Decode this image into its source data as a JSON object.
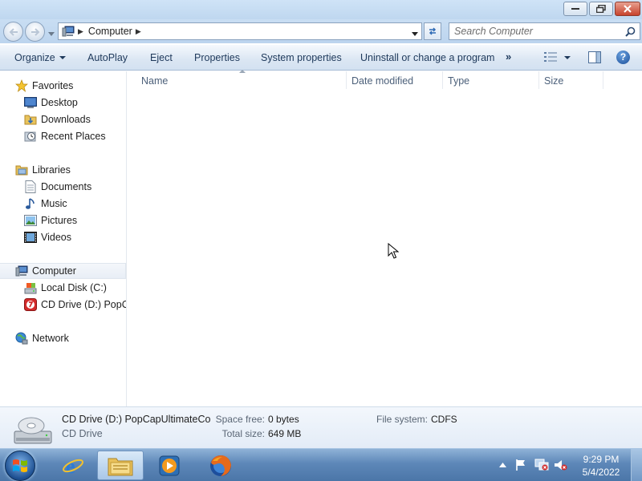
{
  "address": {
    "crumb": "Computer"
  },
  "search": {
    "placeholder": "Search Computer"
  },
  "toolbar": {
    "organize": "Organize",
    "autoplay": "AutoPlay",
    "eject": "Eject",
    "properties": "Properties",
    "system_properties": "System properties",
    "uninstall": "Uninstall or change a program",
    "more": "»",
    "help": "?"
  },
  "nav": {
    "favorites": "Favorites",
    "desktop": "Desktop",
    "downloads": "Downloads",
    "recent_places": "Recent Places",
    "libraries": "Libraries",
    "documents": "Documents",
    "music": "Music",
    "pictures": "Pictures",
    "videos": "Videos",
    "computer": "Computer",
    "local_disk": "Local Disk (C:)",
    "cd_drive": "CD Drive (D:) PopCapUltimateCo",
    "network": "Network"
  },
  "columns": {
    "name": "Name",
    "date_modified": "Date modified",
    "type": "Type",
    "size": "Size"
  },
  "details": {
    "name": "CD Drive (D:) PopCapUltimateCo",
    "type": "CD Drive",
    "space_free_label": "Space free:",
    "space_free_value": "0 bytes",
    "total_size_label": "Total size:",
    "total_size_value": "649 MB",
    "filesystem_label": "File system:",
    "filesystem_value": "CDFS"
  },
  "clock": {
    "time": "9:29 PM",
    "date": "5/4/2022"
  }
}
